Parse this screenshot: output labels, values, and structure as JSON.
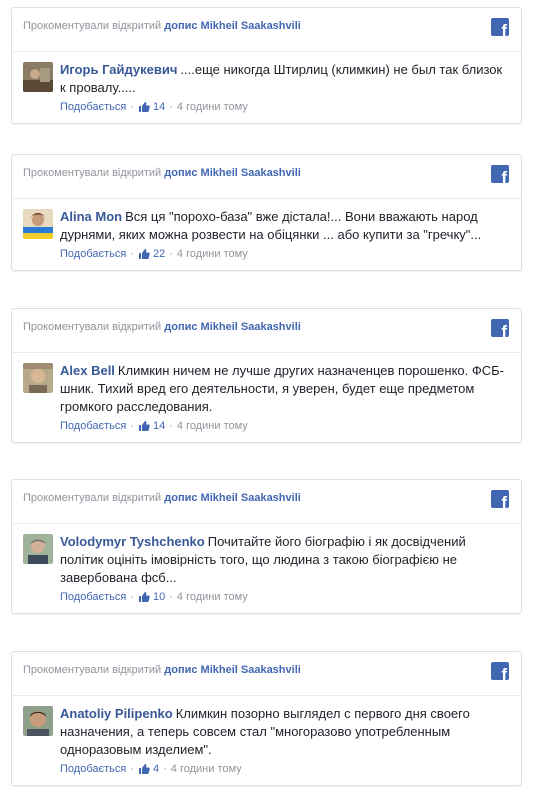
{
  "header_prefix": "Прокоментували відкритий",
  "post_link": "допис Mikheil Saakashvili",
  "like_label": "Подобається",
  "separator": "·",
  "colors": {
    "brand": "#4267b2",
    "author": "#385898",
    "meta": "#90949c",
    "border": "#dddfe2"
  },
  "icons": {
    "facebook": "facebook-icon",
    "like": "thumbs-up-icon"
  },
  "comments": [
    {
      "author": "Игорь Гайдукевич",
      "text": "....еще никогда Штирлиц (климкин) не был так близок к провалу.....",
      "likes": "14",
      "time": "4 години тому"
    },
    {
      "author": "Alina Mon",
      "text": "Вся ця \"порохо-база\" вже дістала!... Вони вважають народ дурнями, яких можна розвести на обіцянки ... або купити за \"гречку\"...",
      "likes": "22",
      "time": "4 години тому"
    },
    {
      "author": "Alex Bell",
      "text": "Климкин ничем не лучше других назначенцев порошенко. ФСБ-шник. Тихий вред его деятельности, я уверен, будет еще предметом громкого расследования.",
      "likes": "14",
      "time": "4 години тому"
    },
    {
      "author": "Volodymyr Tyshchenko",
      "text": "Почитайте його біографію і як досвідчений політик оцініть імовірність того, що людина з такою біографією не завербована фсб...",
      "likes": "10",
      "time": "4 години тому"
    },
    {
      "author": "Anatoliy Pilipenko",
      "text": "Климкин позорно выглядел с первого дня своего назначения, а теперь совсем стал \"многоразово употребленным одноразовым изделием\".",
      "likes": "4",
      "time": "4 години тому"
    }
  ]
}
